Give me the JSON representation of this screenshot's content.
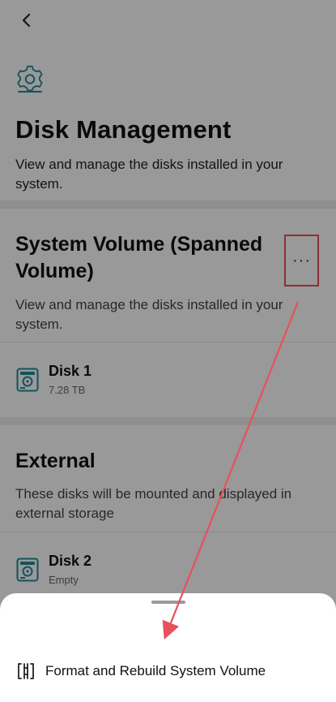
{
  "header": {
    "back_icon": "chevron-left-icon",
    "settings_icon": "gear-icon",
    "title": "Disk Management",
    "description": "View and manage the disks installed in your system."
  },
  "sections": [
    {
      "title": "System Volume (Spanned Volume)",
      "description": "View and manage the disks installed in your system.",
      "more_icon": "ellipsis-icon",
      "disks": [
        {
          "name": "Disk 1",
          "detail": "7.28 TB",
          "icon": "disk-icon"
        }
      ]
    },
    {
      "title": "External",
      "description": "These disks will be mounted and displayed in external storage",
      "disks": [
        {
          "name": "Disk 2",
          "detail": "Empty",
          "icon": "disk-icon"
        }
      ]
    }
  ],
  "bottom_sheet": {
    "items": [
      {
        "label": "Format and Rebuild System Volume",
        "icon": "format-rebuild-icon"
      }
    ]
  },
  "annotation": {
    "highlight_color": "#e8505b"
  }
}
